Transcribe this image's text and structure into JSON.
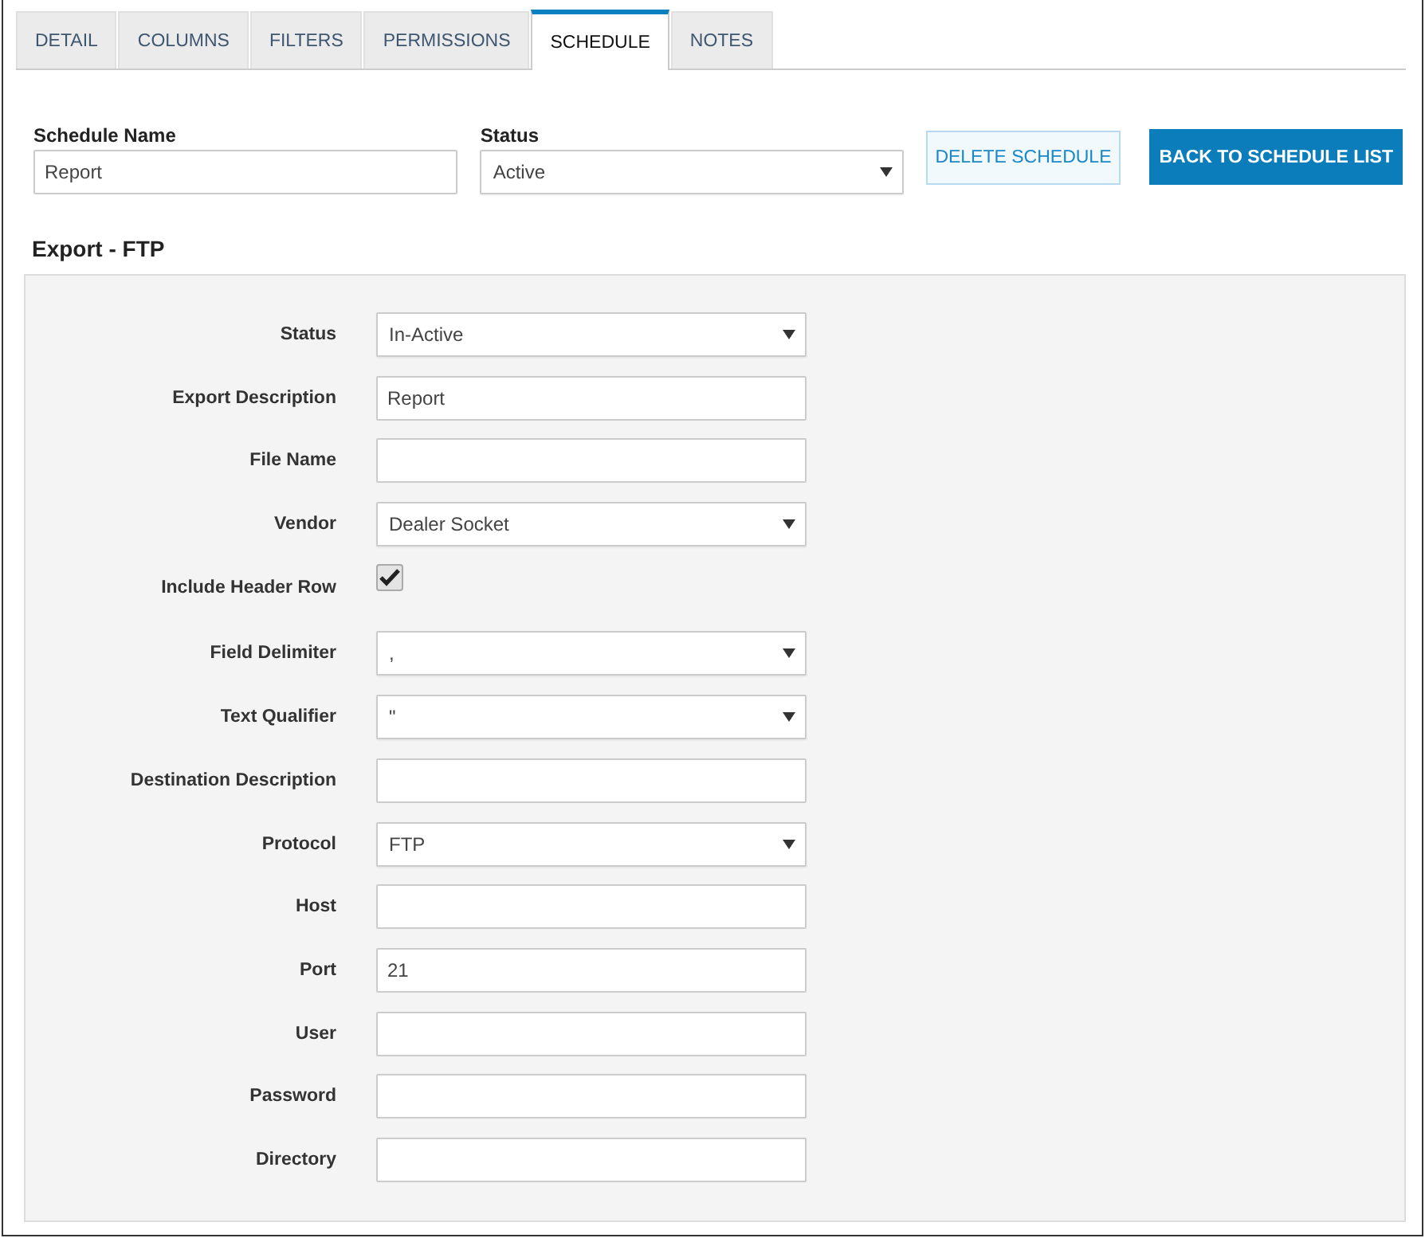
{
  "tabs": [
    {
      "label": "DETAIL",
      "selected": false
    },
    {
      "label": "COLUMNS",
      "selected": false
    },
    {
      "label": "FILTERS",
      "selected": false
    },
    {
      "label": "PERMISSIONS",
      "selected": false
    },
    {
      "label": "SCHEDULE",
      "selected": true
    },
    {
      "label": "NOTES",
      "selected": false
    }
  ],
  "schedule": {
    "name_label": "Schedule Name",
    "name_value": "Report",
    "status_label": "Status",
    "status_value": "Active",
    "delete_button": "DELETE SCHEDULE",
    "back_button": "BACK TO SCHEDULE LIST"
  },
  "section_title": "Export - FTP",
  "fields": [
    {
      "label": "Status",
      "kind": "select",
      "value": "In-Active"
    },
    {
      "label": "Export Description",
      "kind": "text",
      "value": "Report"
    },
    {
      "label": "File Name",
      "kind": "text"
    },
    {
      "label": "Vendor",
      "kind": "select",
      "value": "Dealer Socket"
    },
    {
      "label": "Include Header Row",
      "kind": "checkbox",
      "checked": true
    },
    {
      "label": "Field Delimiter",
      "kind": "select",
      "value": ","
    },
    {
      "label": "Text Qualifier",
      "kind": "select",
      "value": "\""
    },
    {
      "label": "Destination Description",
      "kind": "text"
    },
    {
      "label": "Protocol",
      "kind": "select",
      "value": "FTP"
    },
    {
      "label": "Host",
      "kind": "text"
    },
    {
      "label": "Port",
      "kind": "text",
      "value": "21"
    },
    {
      "label": "User",
      "kind": "text"
    },
    {
      "label": "Password",
      "kind": "text"
    },
    {
      "label": "Directory",
      "kind": "text"
    }
  ]
}
